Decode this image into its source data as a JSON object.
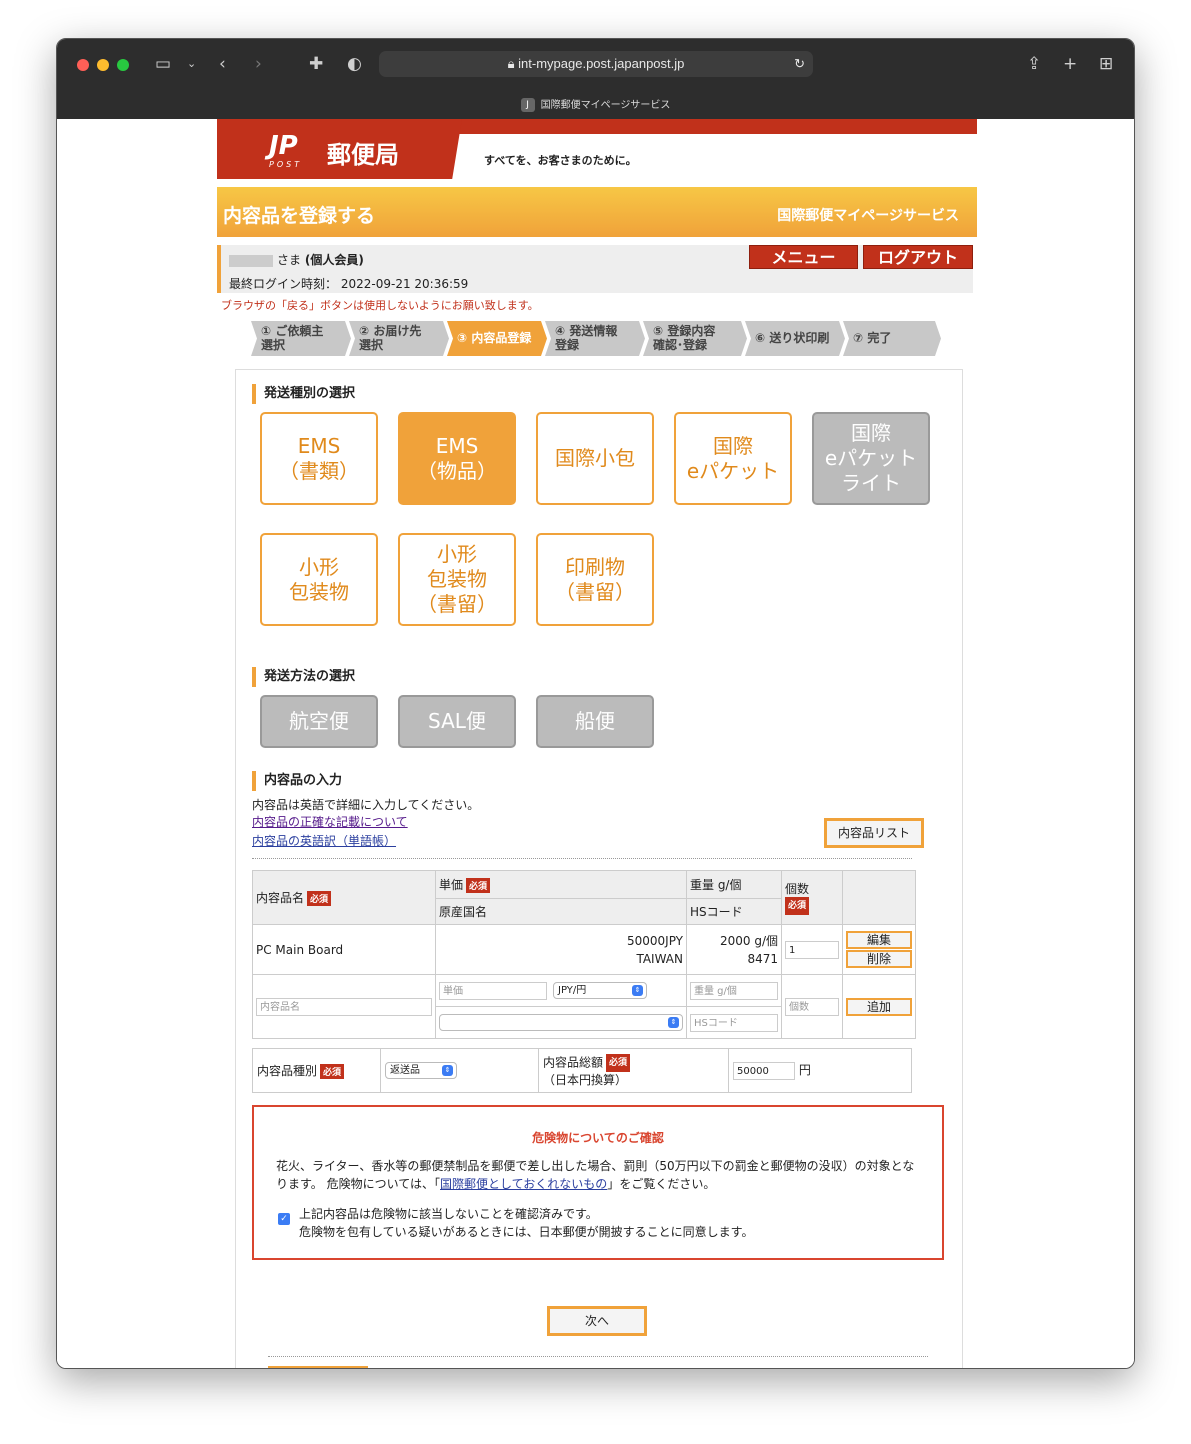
{
  "browser": {
    "url": "int-mypage.post.japanpost.jp",
    "tab_title": "国際郵便マイページサービス",
    "tab_icon_letter": "J"
  },
  "header": {
    "logo_jp": "JP",
    "logo_post": "POST",
    "logo_name": "郵便局",
    "tagline": "すべてを、お客さまのために。"
  },
  "titlebar": {
    "page_title": "内容品を登録する",
    "service_name": "国際郵便マイページサービス"
  },
  "user": {
    "name_suffix": "さま",
    "member_type": "(個人会員)",
    "last_login_label": "最終ログイン時刻：",
    "last_login_value": "2022-09-21 20:36:59",
    "menu_label": "メニュー",
    "logout_label": "ログアウト"
  },
  "warning": "ブラウザの「戻る」ボタンは使用しないようにお願い致します。",
  "steps": [
    {
      "l1": "① ご依頼主",
      "l2": "選択"
    },
    {
      "l1": "② お届け先",
      "l2": "選択"
    },
    {
      "l1": "③ 内容品登録",
      "l2": ""
    },
    {
      "l1": "④ 発送情報",
      "l2": "登録"
    },
    {
      "l1": "⑤ 登録内容",
      "l2": "確認･登録"
    },
    {
      "l1": "⑥ 送り状印刷",
      "l2": ""
    },
    {
      "l1": "⑦ 完了",
      "l2": ""
    }
  ],
  "shipping_type": {
    "heading": "発送種別の選択",
    "options": [
      {
        "l1": "EMS",
        "l2": "（書類）",
        "l3": ""
      },
      {
        "l1": "EMS",
        "l2": "（物品）",
        "l3": ""
      },
      {
        "l1": "国際小包",
        "l2": "",
        "l3": ""
      },
      {
        "l1": "国際",
        "l2": "eパケット",
        "l3": ""
      },
      {
        "l1": "国際",
        "l2": "eパケット",
        "l3": "ライト"
      },
      {
        "l1": "小形",
        "l2": "包装物",
        "l3": ""
      },
      {
        "l1": "小形",
        "l2": "包装物",
        "l3": "（書留）"
      },
      {
        "l1": "印刷物",
        "l2": "（書留）",
        "l3": ""
      }
    ]
  },
  "shipping_method": {
    "heading": "発送方法の選択",
    "options": [
      "航空便",
      "SAL便",
      "船便"
    ]
  },
  "contents": {
    "heading": "内容品の入力",
    "instruction": "内容品は英語で詳細に入力してください。",
    "link1": "内容品の正確な記載について",
    "link2": "内容品の英語訳（単語帳）",
    "list_button": "内容品リスト",
    "table": {
      "h_name": "内容品名",
      "h_price": "単価",
      "h_weight": "重量 g/個",
      "h_qty": "個数",
      "h_country": "原産国名",
      "h_hs": "HSコード",
      "required": "必須",
      "row": {
        "name": "PC Main Board",
        "price": "50000JPY",
        "country": "TAIWAN",
        "weight": "2000 g/個",
        "hs": "8471",
        "qty": "1",
        "edit": "編集",
        "delete": "削除"
      },
      "new_row": {
        "name_ph": "内容品名",
        "price_ph": "単価",
        "currency": "JPY/円",
        "weight_ph": "重量 g/個",
        "hs_ph": "HSコード",
        "qty_ph": "個数",
        "add": "追加"
      }
    },
    "type_label": "内容品種別",
    "type_value": "返送品",
    "total_label": "内容品総額",
    "total_sub": "（日本円換算）",
    "total_value": "50000",
    "yen": "円"
  },
  "danger": {
    "title": "危険物についてのご確認",
    "text1": "花火、ライター、香水等の郵便禁制品を郵便で差し出した場合、罰則（50万円以下の罰金と郵便物の没収）の対象とな",
    "text2a": "ります。 危険物については、「",
    "text2link": "国際郵便としておくれないもの",
    "text2b": "」をご覧ください。",
    "check1": "上記内容品は危険物に該当しないことを確認済みです。",
    "check2": "危険物を包有している疑いがあるときには、日本郵便が開披することに同意します。"
  },
  "next_button": "次へ",
  "colors": {
    "accent": "#f0a23a",
    "brand_red": "#c1311b"
  }
}
